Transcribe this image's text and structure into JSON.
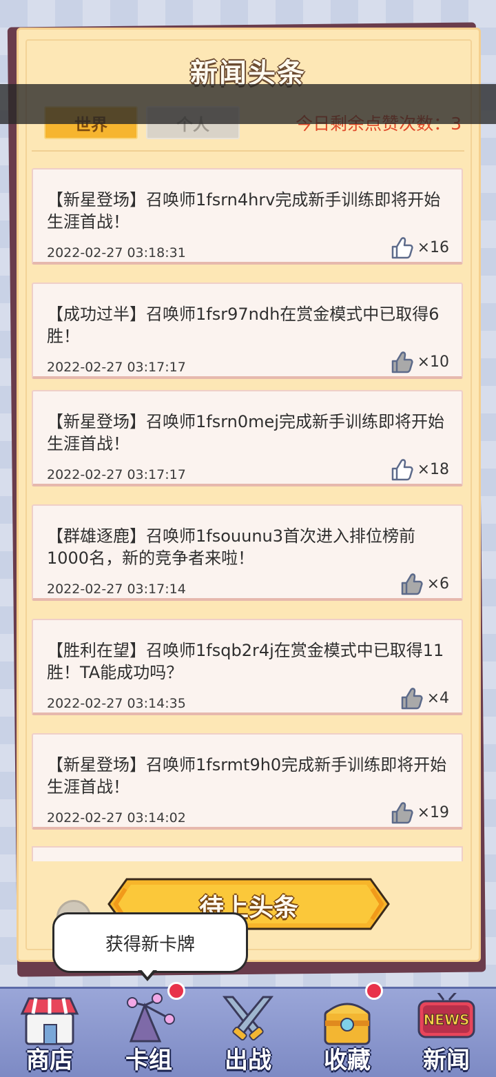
{
  "header": {
    "title": "新闻头条",
    "tabs": [
      {
        "label": "世界",
        "active": true
      },
      {
        "label": "个人",
        "active": false
      }
    ],
    "likes_remaining": "今日剩余点赞次数：3"
  },
  "news": [
    {
      "text": "【新星登场】召唤师1fsrn4hrv完成新手训练即将开始生涯首战！",
      "time": "2022-02-27 03:18:31",
      "likes": "×16",
      "liked": false
    },
    {
      "text": "【成功过半】召唤师1fsr97ndh在赏金模式中已取得6胜！",
      "time": "2022-02-27 03:17:17",
      "likes": "×10",
      "liked": true
    },
    {
      "text": "【新星登场】召唤师1fsrn0mej完成新手训练即将开始生涯首战！",
      "time": "2022-02-27 03:17:17",
      "likes": "×18",
      "liked": false
    },
    {
      "text": "【群雄逐鹿】召唤师1fsouunu3首次进入排位榜前1000名，新的竞争者来啦！",
      "time": "2022-02-27 03:17:14",
      "likes": "×6",
      "liked": true
    },
    {
      "text": "【胜利在望】召唤师1fsqb2r4j在赏金模式中已取得11胜！TA能成功吗？",
      "time": "2022-02-27 03:14:35",
      "likes": "×4",
      "liked": true
    },
    {
      "text": "【新星登场】召唤师1fsrmt9h0完成新手训练即将开始生涯首战！",
      "time": "2022-02-27 03:14:02",
      "likes": "×19",
      "liked": true
    }
  ],
  "headline_button": "待上头条",
  "tooltip": "获得新卡牌",
  "nav": [
    {
      "label": "商店",
      "icon": "shop-icon",
      "badge": false
    },
    {
      "label": "卡组",
      "icon": "cards-icon",
      "badge": true
    },
    {
      "label": "出战",
      "icon": "battle-icon",
      "badge": false
    },
    {
      "label": "收藏",
      "icon": "collection-icon",
      "badge": true
    },
    {
      "label": "新闻",
      "icon": "news-icon",
      "badge": false,
      "icon_text": "NEWS"
    }
  ],
  "colors": {
    "accent": "#f6b52f",
    "likes_text": "#e04a2a",
    "panel": "#fde7b5",
    "nav": "#8a97cf"
  }
}
